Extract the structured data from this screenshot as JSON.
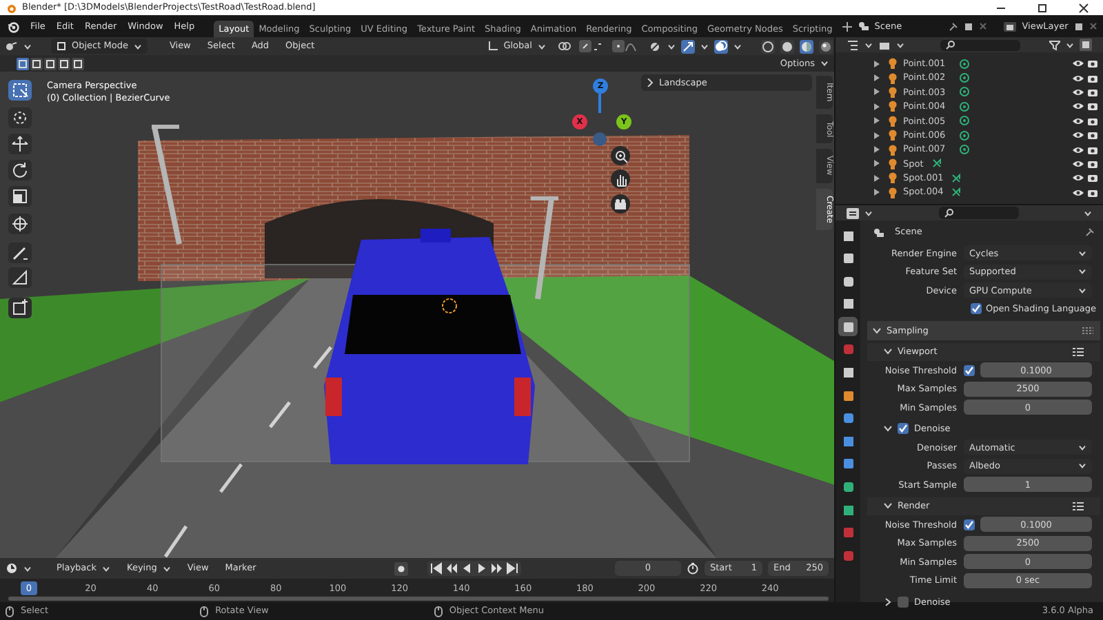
{
  "window": {
    "title": "Blender* [D:\\3DModels\\BlenderProjects\\TestRoad\\TestRoad.blend]"
  },
  "menu": [
    "File",
    "Edit",
    "Render",
    "Window",
    "Help"
  ],
  "workspaces": [
    {
      "label": "Layout",
      "selected": true
    },
    {
      "label": "Modeling",
      "selected": false
    },
    {
      "label": "Sculpting",
      "selected": false
    },
    {
      "label": "UV Editing",
      "selected": false
    },
    {
      "label": "Texture Paint",
      "selected": false
    },
    {
      "label": "Shading",
      "selected": false
    },
    {
      "label": "Animation",
      "selected": false
    },
    {
      "label": "Rendering",
      "selected": false
    },
    {
      "label": "Compositing",
      "selected": false
    },
    {
      "label": "Geometry Nodes",
      "selected": false
    },
    {
      "label": "Scripting",
      "selected": false
    }
  ],
  "scene": "Scene",
  "view_layer": "ViewLayer",
  "viewport": {
    "mode": "Object Mode",
    "menus": [
      "View",
      "Select",
      "Add",
      "Object"
    ],
    "orientation": "Global",
    "header_toggles": [
      {
        "kind": "visibility",
        "on": false
      },
      {
        "kind": "gizmo",
        "on": true
      },
      {
        "kind": "overlay",
        "on": true
      }
    ],
    "shading": [
      {
        "kind": "wireframe",
        "selected": false
      },
      {
        "kind": "solid",
        "selected": false
      },
      {
        "kind": "material",
        "selected": true
      },
      {
        "kind": "rendered",
        "selected": false
      }
    ],
    "select_modes": [
      {
        "selected": true
      },
      {
        "selected": false
      },
      {
        "selected": false
      },
      {
        "selected": false
      },
      {
        "selected": false
      }
    ],
    "options": "Options",
    "overlay_lines": [
      "Camera Perspective",
      "(0) Collection | BezierCurve"
    ],
    "tools": [
      {
        "kind": "select",
        "selected": true
      },
      {
        "kind": "cursor",
        "selected": false
      },
      {
        "kind": "move",
        "selected": false
      },
      {
        "kind": "rotate",
        "selected": false
      },
      {
        "kind": "scale",
        "selected": false
      },
      {
        "kind": "transform",
        "selected": false
      },
      {
        "kind": "annotate",
        "selected": false
      },
      {
        "kind": "measure",
        "selected": false
      },
      {
        "kind": "add_cube",
        "selected": false
      }
    ],
    "gizmo_axes": [
      {
        "label": "Z",
        "color": "#2f7fe0"
      },
      {
        "label": "X",
        "color": "#e0304a"
      },
      {
        "label": "Y",
        "color": "#7cc41a"
      }
    ],
    "panel": {
      "title": "Landscape",
      "expanded": false
    },
    "side_tabs": [
      {
        "label": "Item",
        "selected": false
      },
      {
        "label": "Tool",
        "selected": false
      },
      {
        "label": "View",
        "selected": false
      },
      {
        "label": "Create",
        "selected": true
      }
    ]
  },
  "timeline": {
    "menus": [
      "Playback",
      "Keying",
      "View",
      "Marker"
    ],
    "current_frame": "0",
    "start_label": "Start",
    "start": "1",
    "end_label": "End",
    "end": "250",
    "playhead": "0",
    "ticks": [
      "20",
      "40",
      "60",
      "80",
      "100",
      "120",
      "140",
      "160",
      "180",
      "200",
      "220",
      "240"
    ]
  },
  "outliner": {
    "items": [
      {
        "name": "Point.001",
        "kind": "point"
      },
      {
        "name": "Point.002",
        "kind": "point"
      },
      {
        "name": "Point.003",
        "kind": "point"
      },
      {
        "name": "Point.004",
        "kind": "point"
      },
      {
        "name": "Point.005",
        "kind": "point"
      },
      {
        "name": "Point.006",
        "kind": "point"
      },
      {
        "name": "Point.007",
        "kind": "point"
      },
      {
        "name": "Spot",
        "kind": "spot"
      },
      {
        "name": "Spot.001",
        "kind": "spot"
      },
      {
        "name": "Spot.004",
        "kind": "spot"
      }
    ]
  },
  "properties": {
    "title": "Scene",
    "tabs": [
      {
        "selected": false
      },
      {
        "selected": false
      },
      {
        "selected": false
      },
      {
        "selected": false
      },
      {
        "selected": true
      },
      {
        "selected": false
      },
      {
        "selected": false
      },
      {
        "selected": false
      },
      {
        "selected": false
      },
      {
        "selected": false
      },
      {
        "selected": false
      },
      {
        "selected": false
      },
      {
        "selected": false
      },
      {
        "selected": false
      },
      {
        "selected": false
      }
    ],
    "rows": [
      {
        "kind": "dropdown",
        "label": "Render Engine",
        "value": "Cycles"
      },
      {
        "kind": "dropdown",
        "label": "Feature Set",
        "value": "Supported"
      },
      {
        "kind": "dropdown",
        "label": "Device",
        "value": "GPU Compute"
      },
      {
        "kind": "checkbox",
        "label": "Open Shading Language",
        "checked": true
      },
      {
        "kind": "panel",
        "label": "Sampling",
        "expanded": true
      },
      {
        "kind": "subpanel",
        "label": "Viewport",
        "expanded": true
      },
      {
        "kind": "toggle_number",
        "label": "Noise Threshold",
        "value": "0.1000",
        "checked": true
      },
      {
        "kind": "number",
        "label": "Max Samples",
        "value": "2500"
      },
      {
        "kind": "number",
        "label": "Min Samples",
        "value": "0"
      },
      {
        "kind": "subpanel_check",
        "label": "Denoise",
        "expanded": true,
        "checked": true
      },
      {
        "kind": "dropdown",
        "label": "Denoiser",
        "value": "Automatic"
      },
      {
        "kind": "dropdown",
        "label": "Passes",
        "value": "Albedo"
      },
      {
        "kind": "number",
        "label": "Start Sample",
        "value": "1"
      },
      {
        "kind": "subpanel",
        "label": "Render",
        "expanded": true
      },
      {
        "kind": "toggle_number",
        "label": "Noise Threshold",
        "value": "0.1000",
        "checked": true
      },
      {
        "kind": "number",
        "label": "Max Samples",
        "value": "2500"
      },
      {
        "kind": "number",
        "label": "Min Samples",
        "value": "0"
      },
      {
        "kind": "number",
        "label": "Time Limit",
        "value": "0 sec"
      },
      {
        "kind": "subpanel_check",
        "label": "Denoise",
        "expanded": false,
        "checked": false
      }
    ]
  },
  "status_bar": {
    "hints": [
      "Select",
      "Rotate View",
      "Object Context Menu"
    ],
    "version": "3.6.0 Alpha"
  }
}
